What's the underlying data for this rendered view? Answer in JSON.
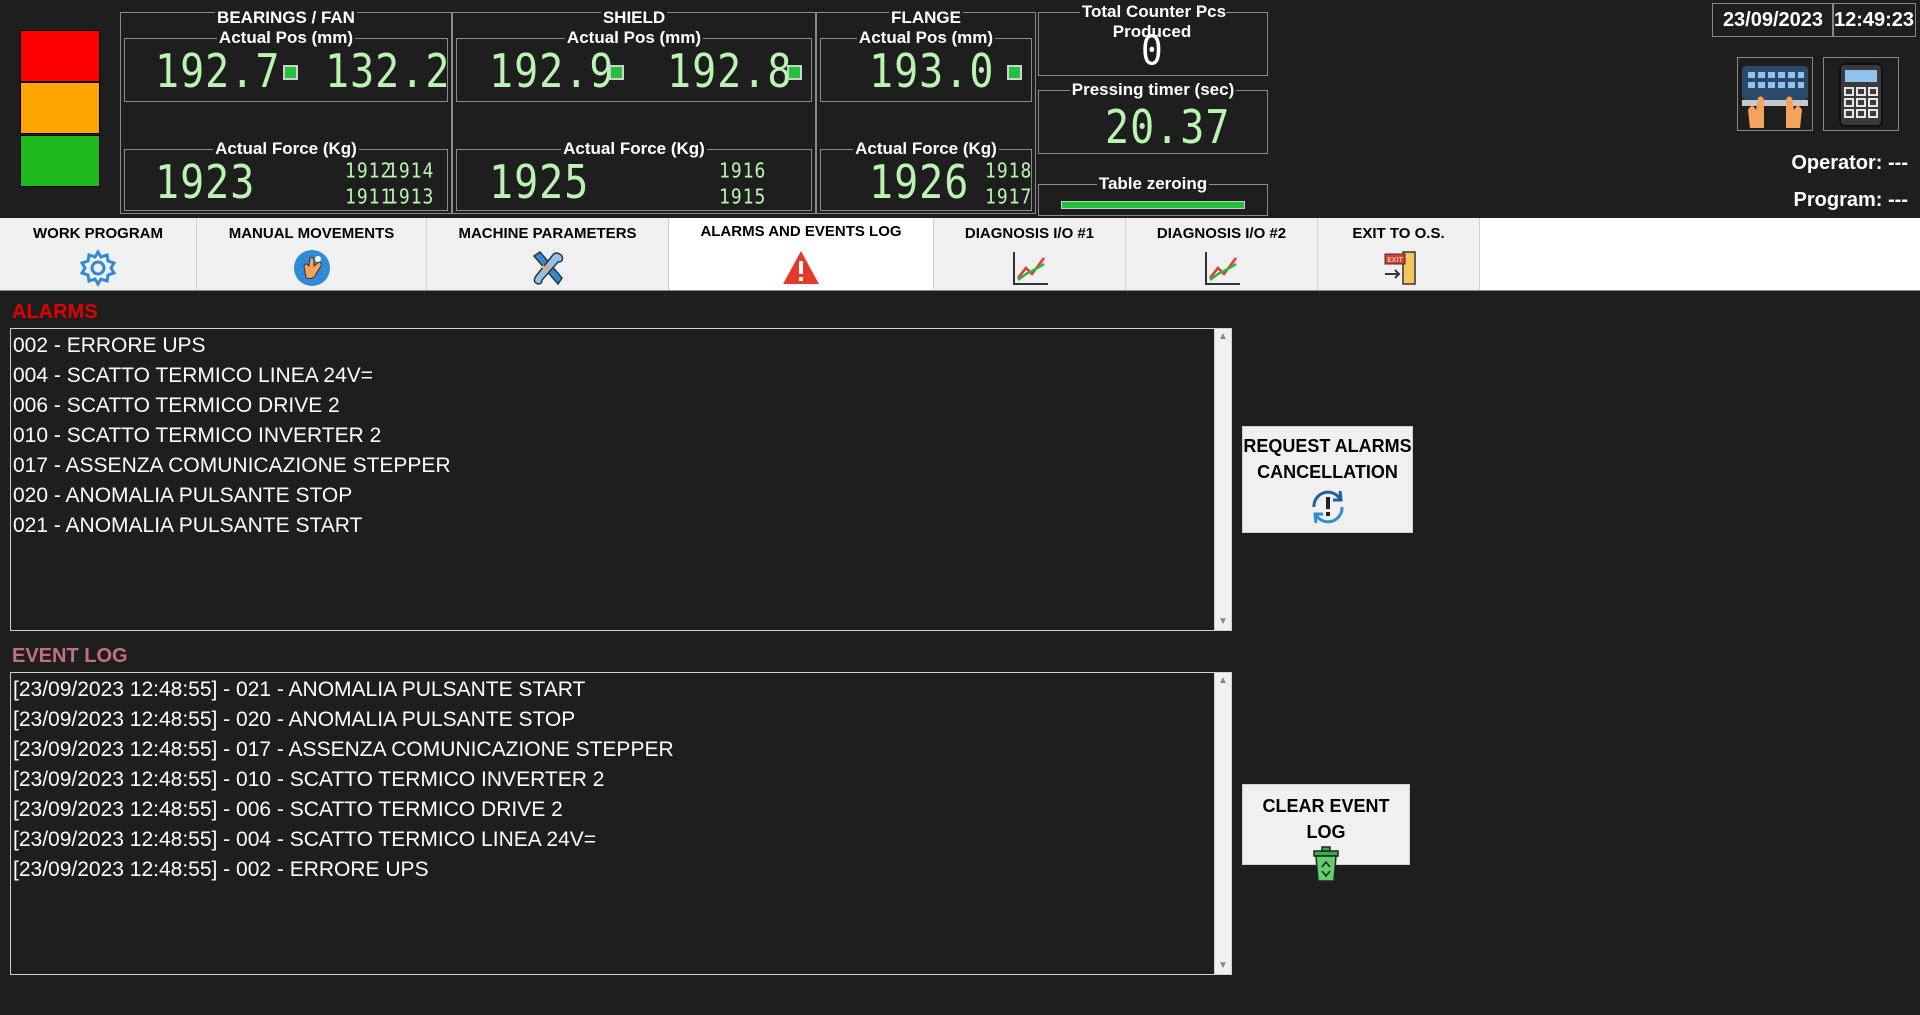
{
  "signal_tower": {
    "colors": {
      "red": "#ff0000",
      "amber": "#ffa500",
      "green": "#1db91d"
    }
  },
  "bearings_fan": {
    "title": "BEARINGS / FAN",
    "pos_label": "Actual Pos (mm)",
    "pos_left": "192.7",
    "pos_right": "132.2",
    "force_label": "Actual Force (Kg)",
    "force": "1923",
    "force_small": [
      "1912",
      "1914",
      "1911",
      "1913"
    ]
  },
  "shield": {
    "title": "SHIELD",
    "pos_label": "Actual Pos (mm)",
    "pos_left": "192.9",
    "pos_right": "192.8",
    "force_label": "Actual Force (Kg)",
    "force": "1925",
    "force_small": [
      "1916",
      "1915"
    ]
  },
  "flange": {
    "title": "FLANGE",
    "pos_label": "Actual Pos (mm)",
    "pos": "193.0",
    "force_label": "Actual Force (Kg)",
    "force": "1926",
    "force_small": [
      "1918",
      "1917"
    ]
  },
  "counters": {
    "total_label": "Total Counter Pcs Produced",
    "total_value": "0",
    "timer_label": "Pressing timer (sec)",
    "timer_value": "20.37",
    "zeroing_label": "Table zeroing",
    "zeroing_progress": 1.0
  },
  "header_right": {
    "date": "23/09/2023",
    "time": "12:49:23",
    "keyboard_icon": "keyboard-icon",
    "calculator_icon": "calculator-icon",
    "operator": "Operator: ---",
    "program": "Program: ---"
  },
  "tabs": [
    {
      "label": "WORK PROGRAM",
      "icon": "gear-icon"
    },
    {
      "label": "MANUAL MOVEMENTS",
      "icon": "hand-icon"
    },
    {
      "label": "MACHINE PARAMETERS",
      "icon": "tools-icon"
    },
    {
      "label": "ALARMS AND EVENTS LOG",
      "icon": "warning-icon",
      "active": true
    },
    {
      "label": "DIAGNOSIS I/O #1",
      "icon": "chart-icon"
    },
    {
      "label": "DIAGNOSIS I/O #2",
      "icon": "chart-icon"
    },
    {
      "label": "EXIT TO O.S.",
      "icon": "exit-icon"
    }
  ],
  "alarms": {
    "title": "ALARMS",
    "title_color": "#e00000",
    "items": [
      "002 - ERRORE UPS",
      "004 - SCATTO TERMICO LINEA 24V=",
      "006 - SCATTO TERMICO DRIVE 2",
      "010 - SCATTO TERMICO INVERTER 2",
      "017 - ASSENZA COMUNICAZIONE STEPPER",
      "020 - ANOMALIA PULSANTE STOP",
      "021 - ANOMALIA PULSANTE START"
    ],
    "button_line1": "REQUEST ALARMS",
    "button_line2": "CANCELLATION"
  },
  "event_log": {
    "title": "EVENT LOG",
    "title_color": "#c07080",
    "items": [
      "[23/09/2023 12:48:55] - 021 - ANOMALIA PULSANTE START",
      "[23/09/2023 12:48:55] - 020 - ANOMALIA PULSANTE STOP",
      "[23/09/2023 12:48:55] - 017 - ASSENZA COMUNICAZIONE STEPPER",
      "[23/09/2023 12:48:55] - 010 - SCATTO TERMICO INVERTER 2",
      "[23/09/2023 12:48:55] - 006 - SCATTO TERMICO DRIVE 2",
      "[23/09/2023 12:48:55] - 004 - SCATTO TERMICO LINEA 24V=",
      "[23/09/2023 12:48:55] - 002 - ERRORE UPS"
    ],
    "button_label": "CLEAR EVENT LOG"
  }
}
